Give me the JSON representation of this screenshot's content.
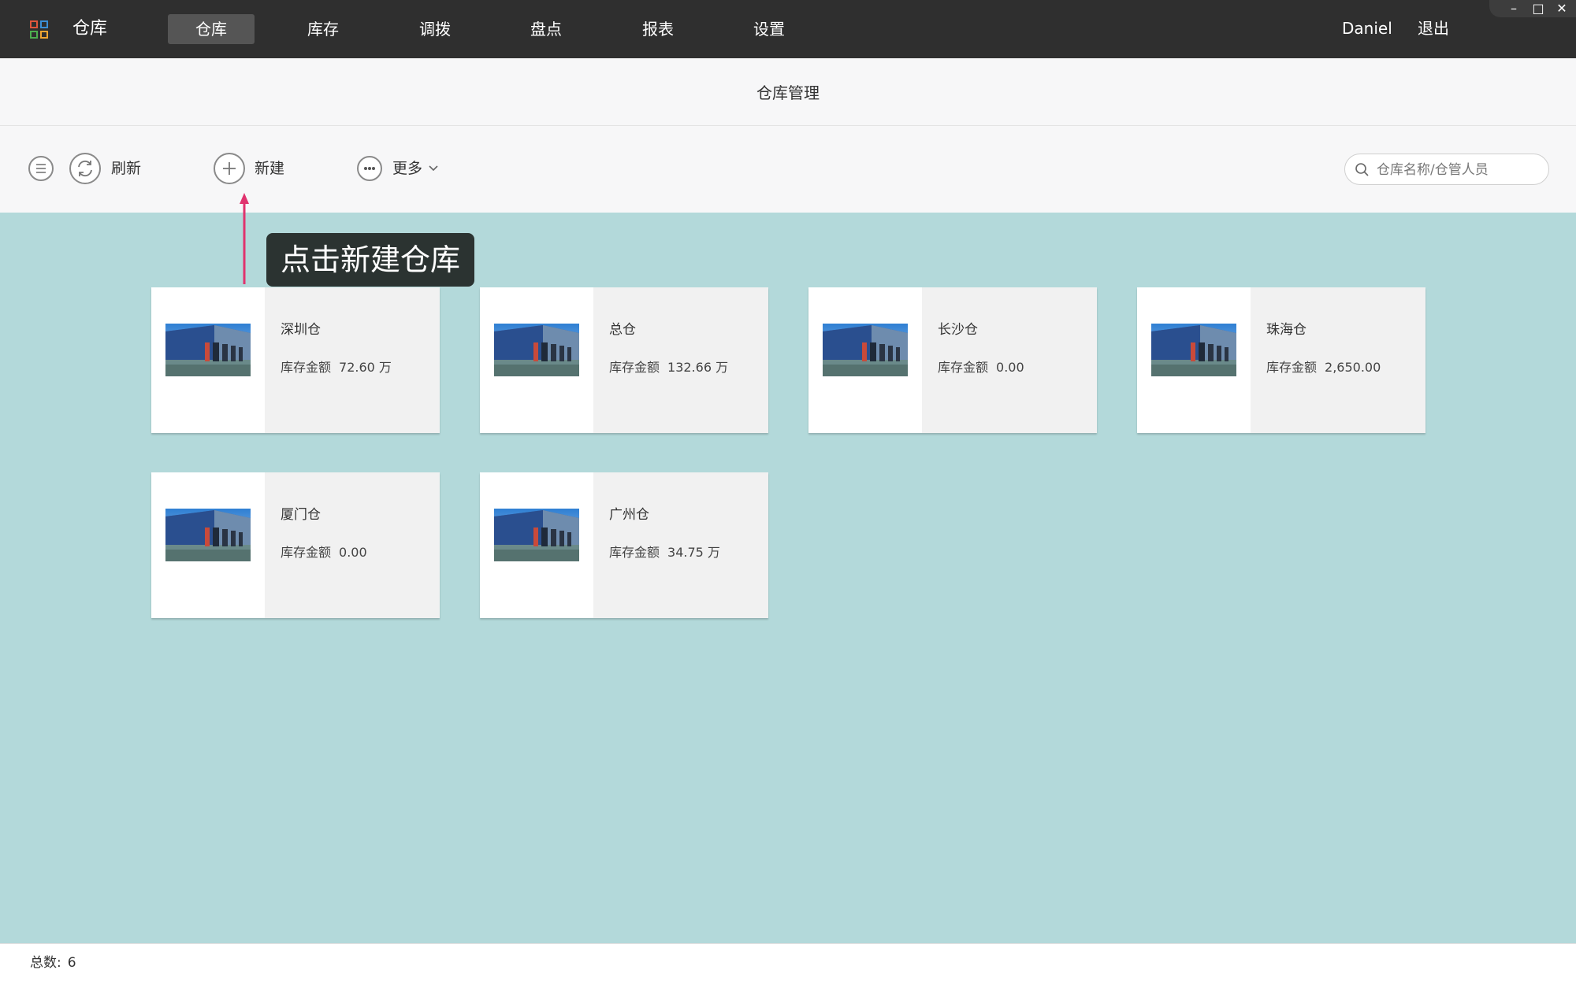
{
  "app": {
    "title": "仓库"
  },
  "nav": [
    {
      "label": "仓库",
      "active": true
    },
    {
      "label": "库存",
      "active": false
    },
    {
      "label": "调拨",
      "active": false
    },
    {
      "label": "盘点",
      "active": false
    },
    {
      "label": "报表",
      "active": false
    },
    {
      "label": "设置",
      "active": false
    }
  ],
  "user": {
    "name": "Daniel",
    "logout_label": "退出"
  },
  "window_controls": {
    "minimize": "–",
    "maximize": "□",
    "close": "✕"
  },
  "page": {
    "title": "仓库管理"
  },
  "toolbar": {
    "menu_icon": "list-icon",
    "refresh_label": "刷新",
    "new_label": "新建",
    "more_label": "更多",
    "search_placeholder": "仓库名称/仓管人员"
  },
  "annotation": {
    "text": "点击新建仓库"
  },
  "warehouses": [
    {
      "name": "深圳仓",
      "amount_label": "库存金额",
      "amount": "72.60 万"
    },
    {
      "name": "总仓",
      "amount_label": "库存金额",
      "amount": "132.66 万"
    },
    {
      "name": "长沙仓",
      "amount_label": "库存金额",
      "amount": "0.00"
    },
    {
      "name": "珠海仓",
      "amount_label": "库存金额",
      "amount": "2,650.00"
    },
    {
      "name": "厦门仓",
      "amount_label": "库存金额",
      "amount": "0.00"
    },
    {
      "name": "广州仓",
      "amount_label": "库存金额",
      "amount": "34.75 万"
    }
  ],
  "status": {
    "total_label": "总数:",
    "total": "6"
  },
  "colors": {
    "topbar": "#2f2f2f",
    "content_bg": "#b3d9da",
    "annotation_arrow": "#e0336e",
    "tooltip_bg": "#2b3331"
  }
}
